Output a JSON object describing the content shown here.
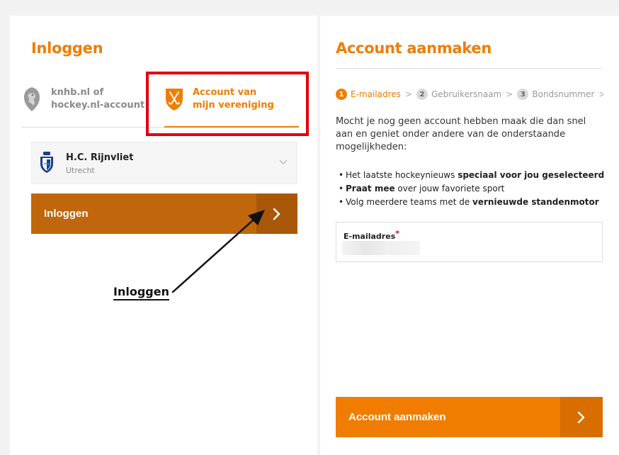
{
  "login": {
    "title": "Inloggen",
    "tab_knhb_line1": "knhb.nl of",
    "tab_knhb_line2": "hockey.nl-account",
    "tab_club_line1": "Account van",
    "tab_club_line2": "mijn vereniging",
    "club": {
      "name": "H.C. Rijnvliet",
      "city": "Utrecht"
    },
    "button_label": "Inloggen"
  },
  "annotation": {
    "text": "Inloggen"
  },
  "register": {
    "title": "Account aanmaken",
    "steps": [
      {
        "num": "1",
        "label": "E-mailadres"
      },
      {
        "num": "2",
        "label": "Gebruikersnaam"
      },
      {
        "num": "3",
        "label": "Bondsnummer"
      }
    ],
    "step_separator": ">",
    "intro": "Mocht je nog geen account hebben maak die dan snel aan en geniet onder andere van de onderstaande mogelijkheden:",
    "benefits": [
      {
        "pre": "Het laatste hockeynieuws ",
        "bold": "speciaal voor jou geselecteerd",
        "post": ""
      },
      {
        "pre": "",
        "bold": "Praat mee",
        "post": " over jouw favoriete sport"
      },
      {
        "pre": "Volg meerdere teams met de ",
        "bold": "vernieuwde standenmotor",
        "post": ""
      }
    ],
    "email_label": "E-mailadres",
    "email_required_mark": "*",
    "button_label": "Account aanmaken"
  },
  "colors": {
    "accent": "#f07d00",
    "login_button": "#c0660c",
    "highlight": "#e1000f"
  },
  "icons": [
    "knhb-lion-icon",
    "hockey-sticks-shield-icon",
    "club-logo-icon",
    "chevron-down-icon",
    "chevron-right-icon"
  ]
}
